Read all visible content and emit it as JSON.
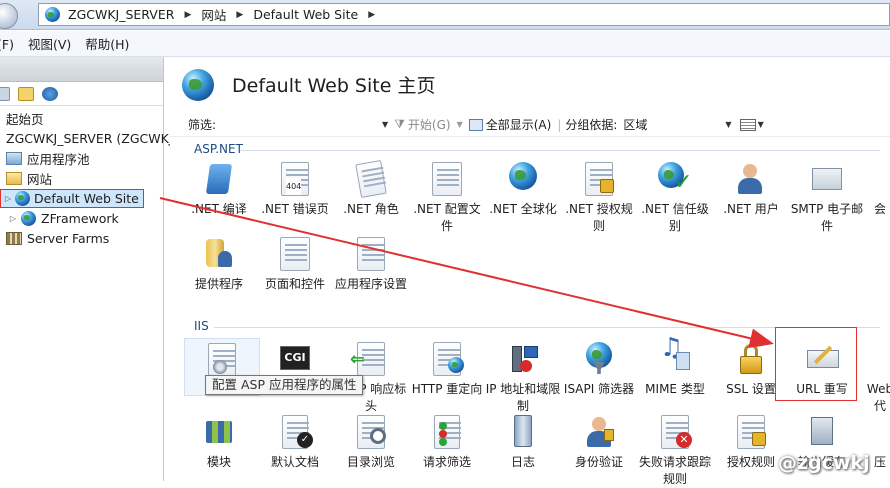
{
  "breadcrumb": [
    "ZGCWKJ_SERVER",
    "网站",
    "Default Web Site"
  ],
  "menu": [
    "文件(F)",
    "视图(V)",
    "帮助(H)"
  ],
  "tree": {
    "start_page": "起始页",
    "server": "ZGCWKJ_SERVER (ZGCWKJ",
    "app_pools": "应用程序池",
    "sites": "网站",
    "default_site": "Default Web Site",
    "zframework": "ZFramework",
    "server_farms": "Server Farms"
  },
  "page_title": "Default Web Site 主页",
  "filterbar": {
    "filter_label": "筛选:",
    "go": "开始(G)",
    "show_all": "全部显示(A)",
    "group_label": "分组依据:",
    "group_value": "区域"
  },
  "sections": {
    "aspnet": "ASP.NET",
    "iis": "IIS"
  },
  "aspnet_tiles": [
    ".NET 编译",
    ".NET 错误页",
    ".NET 角色",
    ".NET 配置文件",
    ".NET 全球化",
    ".NET 授权规则",
    ".NET 信任级别",
    ".NET 用户",
    "SMTP 电子邮件",
    "会",
    "提供程序",
    "页面和控件",
    "应用程序设置"
  ],
  "iis_tiles": [
    "ASP",
    "CGI",
    "HTTP 响应标头",
    "HTTP 重定向",
    "IP 地址和域限制",
    "ISAPI 筛选器",
    "MIME 类型",
    "SSL 设置",
    "URL 重写",
    "Web 代",
    "模块",
    "默认文档",
    "目录浏览",
    "请求筛选",
    "日志",
    "身份验证",
    "失败请求跟踪规则",
    "授权规则",
    "输出缓存",
    "压"
  ],
  "tooltip": "配置 ASP 应用程序的属性",
  "tile_404": "404",
  "tile_cgi": "CGI",
  "watermark": "@zgcwkj",
  "colors": {
    "highlight_red": "#e03030",
    "selection_blue": "#cde6fb",
    "section_blue": "#1b4b86"
  }
}
